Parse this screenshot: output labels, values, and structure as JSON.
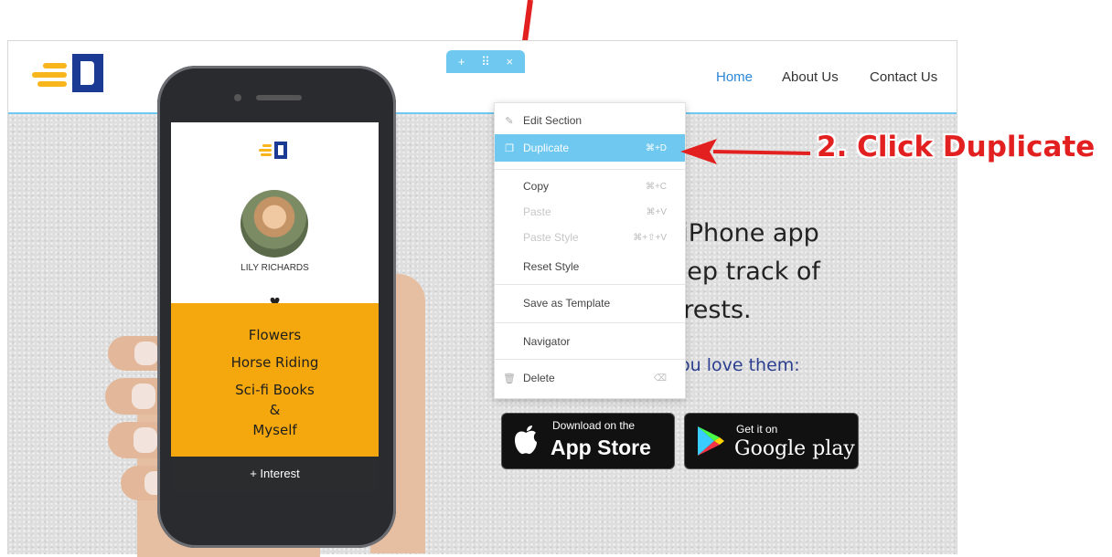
{
  "header": {
    "logo": "logo",
    "nav": [
      "Home",
      "About Us",
      "Contact Us"
    ],
    "active_nav": "Home"
  },
  "section_handle": {
    "add": "+",
    "move": "⠿",
    "close": "×"
  },
  "context_menu": {
    "items": [
      {
        "label": "Edit Section",
        "shortcut": "",
        "icon": "pencil-icon",
        "disabled": false
      },
      {
        "label": "Duplicate",
        "shortcut": "⌘+D",
        "icon": "duplicate-icon",
        "disabled": false,
        "highlighted": true
      },
      {
        "label": "Copy",
        "shortcut": "⌘+C",
        "icon": "",
        "disabled": false
      },
      {
        "label": "Paste",
        "shortcut": "⌘+V",
        "icon": "",
        "disabled": true
      },
      {
        "label": "Paste Style",
        "shortcut": "⌘+⇧+V",
        "icon": "",
        "disabled": true
      },
      {
        "label": "Reset Style",
        "shortcut": "",
        "icon": "",
        "disabled": false
      },
      {
        "label": "Save as Template",
        "shortcut": "",
        "icon": "",
        "disabled": false
      },
      {
        "label": "Navigator",
        "shortcut": "",
        "icon": "",
        "disabled": false
      },
      {
        "label": "Delete",
        "shortcut": "⌫",
        "icon": "trash-icon",
        "disabled": false
      }
    ]
  },
  "hero": {
    "lines": [
      "e iPhone app",
      "keep track of",
      "terests."
    ],
    "love_line": "ou love them:"
  },
  "store_buttons": {
    "apple": {
      "small": "Download on the",
      "big": "App Store"
    },
    "google": {
      "small": "Get it on",
      "big": "Google play"
    }
  },
  "phone_app": {
    "name": "LILY RICHARDS",
    "interests": [
      "Flowers",
      "Horse Riding",
      "Sci-fi Books",
      "&",
      "Myself"
    ],
    "add_button": "+ Interest"
  },
  "annotation": {
    "callout": "2. Click Duplicate"
  },
  "colors": {
    "accent": "#6ec8ef",
    "brand_blue": "#1a3a94",
    "brand_yellow": "#f8b51c",
    "callout_red": "#e32020",
    "phone_panel": "#f5a80d"
  }
}
